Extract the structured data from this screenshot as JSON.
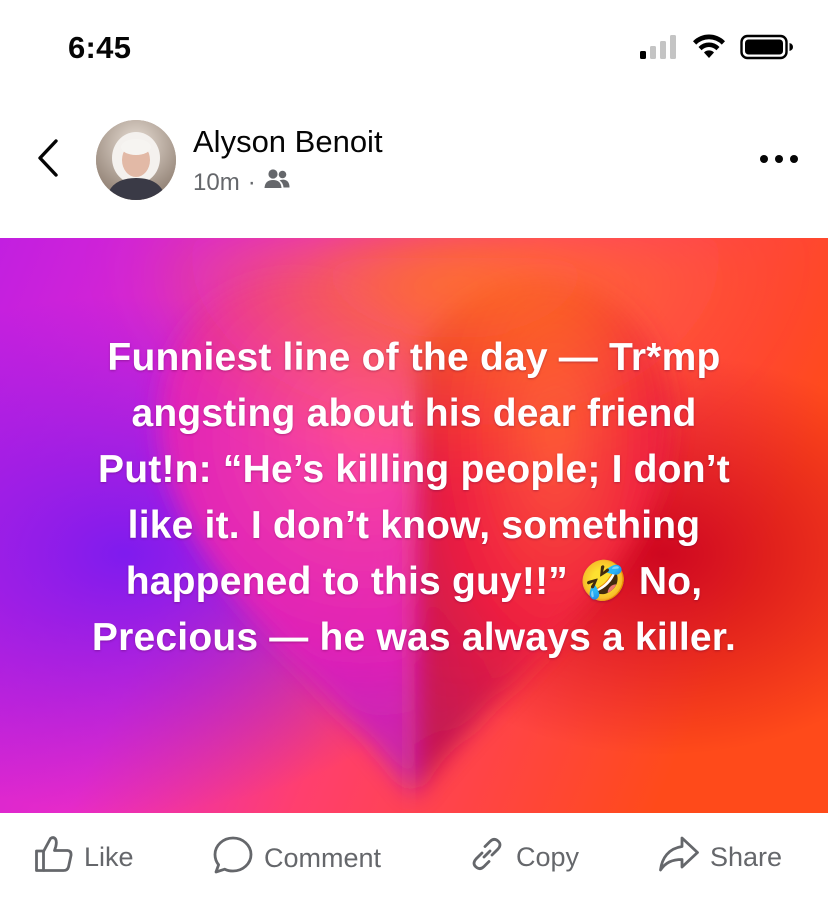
{
  "status_bar": {
    "time": "6:45",
    "icons": [
      "signal-icon",
      "wifi-icon",
      "battery-icon"
    ]
  },
  "post": {
    "author": "Alyson Benoit",
    "time_ago": "10m",
    "separator": "·",
    "audience_icon": "friends-icon",
    "text": "Funniest line of the day — Tr*mp angsting about his dear friend Put!n: “He’s killing people; I don’t like it. I don’t know, something happened to this guy!!” 🤣 No, Precious — he was always a killer.",
    "background_colors": {
      "magenta": "#e62ac9",
      "purple": "#8a1ee6",
      "orange": "#ff5a1e",
      "red": "#d8102a"
    }
  },
  "actions": {
    "like": "Like",
    "comment": "Comment",
    "copy": "Copy",
    "share": "Share"
  }
}
